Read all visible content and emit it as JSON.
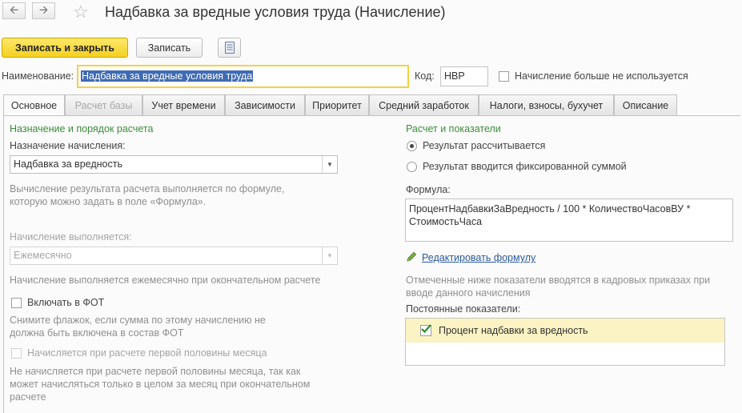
{
  "window": {
    "title": "Надбавка за вредные условия труда (Начисление)",
    "back_icon": "arrow-left-icon",
    "forward_icon": "arrow-right-icon",
    "favorite_icon": "star-icon"
  },
  "toolbar": {
    "save_close_label": "Записать и закрыть",
    "save_label": "Записать",
    "report_icon": "document-list-icon"
  },
  "header_fields": {
    "name_label": "Наименование:",
    "name_value": "Надбавка за вредные условия труда",
    "code_label": "Код:",
    "code_value": "НВР",
    "unused_label": "Начисление больше не используется",
    "unused_checked": false
  },
  "tabs": [
    {
      "label": "Основное",
      "state": "active"
    },
    {
      "label": "Расчет базы",
      "state": "disabled"
    },
    {
      "label": "Учет времени",
      "state": "normal"
    },
    {
      "label": "Зависимости",
      "state": "normal"
    },
    {
      "label": "Приоритет",
      "state": "normal"
    },
    {
      "label": "Средний заработок",
      "state": "normal"
    },
    {
      "label": "Налоги, взносы, бухучет",
      "state": "normal"
    },
    {
      "label": "Описание",
      "state": "normal"
    }
  ],
  "left": {
    "section_title": "Назначение и порядок расчета",
    "purpose_label": "Назначение начисления:",
    "purpose_value": "Надбавка за вредность",
    "purpose_hint_1": "Вычисление результата расчета выполняется по формуле,",
    "purpose_hint_2": "которую можно задать в поле «Формула».",
    "period_label": "Начисление выполняется:",
    "period_value": "Ежемесячно",
    "period_hint": "Начисление выполняется ежемесячно при окончательном расчете",
    "fot_label": "Включать в ФОТ",
    "fot_checked": false,
    "fot_hint_1": "Снимите флажок, если сумма по этому начислению не",
    "fot_hint_2": "должна быть включена в состав ФОТ",
    "half_label": "Начисляется при расчете первой половины месяца",
    "half_checked": false,
    "half_hint_1": "Не начисляется при расчете первой половины месяца, так как",
    "half_hint_2": "может начисляться только в целом за месяц при окончательном",
    "half_hint_3": "расчете"
  },
  "right": {
    "section_title": "Расчет и показатели",
    "radio_calculated": "Результат рассчитывается",
    "radio_fixed": "Результат вводится фиксированной суммой",
    "selected_radio": "calculated",
    "formula_label": "Формула:",
    "formula_line_1": "ПроцентНадбавкиЗаВредность / 100 * КоличествоЧасовВУ *",
    "formula_line_2": "СтоимостьЧаса",
    "edit_formula_link": "Редактировать формулу",
    "edit_icon": "pencil-icon",
    "indicators_hint_1": "Отмеченные ниже показатели вводятся в кадровых приказах при",
    "indicators_hint_2": "вводе данного начисления",
    "constant_indicators_label": "Постоянные показатели:",
    "indicators": [
      {
        "label": "Процент надбавки за вредность",
        "checked": true
      }
    ]
  },
  "colors": {
    "accent_yellow": "#f4d021",
    "section_green": "#3b8d3b",
    "link_blue": "#2a5a9c",
    "selection_blue": "#3f6bb3",
    "row_highlight": "#fbf3c3"
  }
}
